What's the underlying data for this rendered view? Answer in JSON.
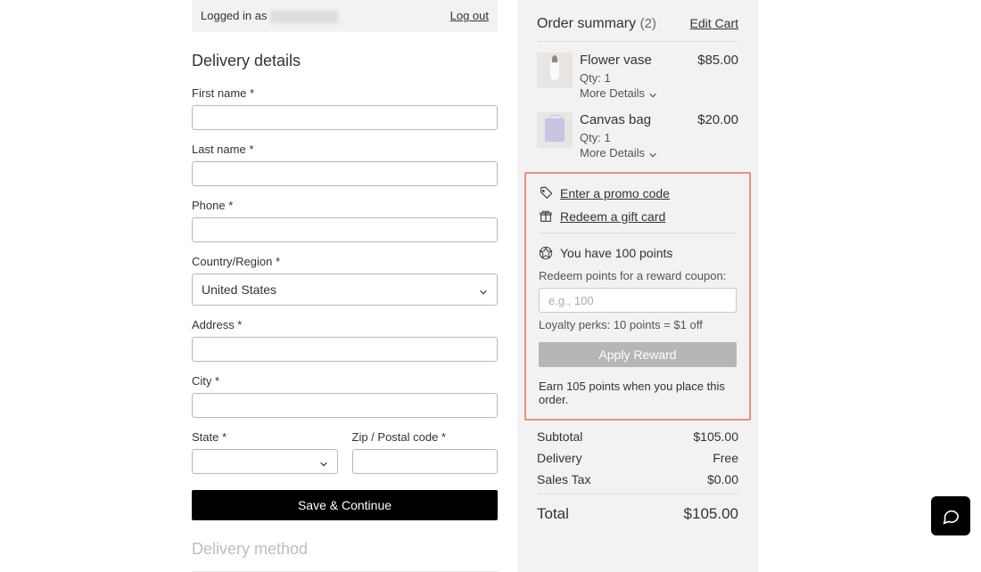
{
  "login": {
    "prefix": "Logged in as ",
    "logout": "Log out"
  },
  "delivery": {
    "title": "Delivery details",
    "first_name_label": "First name *",
    "last_name_label": "Last name *",
    "phone_label": "Phone *",
    "country_label": "Country/Region *",
    "country_value": "United States",
    "address_label": "Address *",
    "city_label": "City *",
    "state_label": "State *",
    "zip_label": "Zip / Postal code *",
    "save_continue": "Save & Continue",
    "delivery_method_title": "Delivery method"
  },
  "summary": {
    "title": "Order summary",
    "count": "(2)",
    "edit_cart": "Edit Cart",
    "items": [
      {
        "name": "Flower vase",
        "price": "$85.00",
        "qty": "Qty: 1",
        "more": "More Details"
      },
      {
        "name": "Canvas bag",
        "price": "$20.00",
        "qty": "Qty: 1",
        "more": "More Details"
      }
    ],
    "promo_link": "Enter a promo code",
    "gift_link": "Redeem a gift card",
    "points_have": "You have 100 points",
    "redeem_label": "Redeem points for a reward coupon:",
    "points_placeholder": "e.g., 100",
    "perk_hint": "Loyalty perks: 10 points = $1 off",
    "apply_reward": "Apply Reward",
    "earn_note": "Earn 105 points when you place this order.",
    "subtotal_label": "Subtotal",
    "subtotal_value": "$105.00",
    "delivery_label": "Delivery",
    "delivery_value": "Free",
    "tax_label": "Sales Tax",
    "tax_value": "$0.00",
    "total_label": "Total",
    "total_value": "$105.00"
  }
}
